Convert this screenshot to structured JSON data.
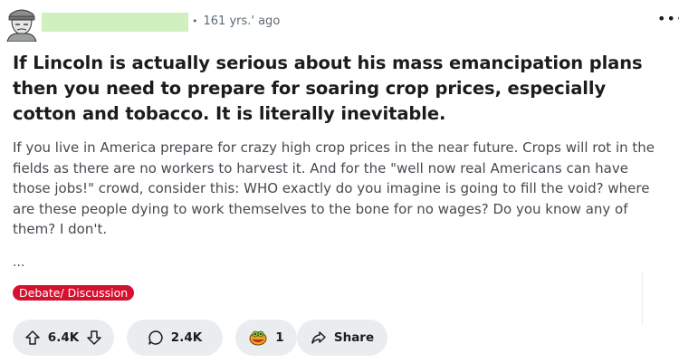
{
  "post": {
    "age": "161 yrs.' ago",
    "more_label": "•••",
    "title": "If Lincoln is actually serious about his mass emancipation plans then you need to prepare for soaring crop prices, especially cotton and tobacco. It is literally inevitable.",
    "body": "If you live in America prepare for crazy high crop prices in the near future. Crops will rot in the fields as there are no workers to harvest it. And for the \"well now real Americans can have those jobs!\" crowd, consider this: WHO exactly do you imagine is going to fill the void? where are these people dying to work themselves to the bone for no wages? Do you know any of them? I don't.",
    "ellipsis": "...",
    "flair": "Debate/ Discussion"
  },
  "actions": {
    "votes": "6.4K",
    "comments": "2.4K",
    "awards": "1",
    "share": "Share"
  },
  "colors": {
    "flair_bg": "#d4112f",
    "pill_bg": "#eaedef",
    "redacted": "#d0f0c0"
  },
  "icons": [
    "avatar",
    "upvote-icon",
    "downvote-icon",
    "comment-icon",
    "award-icon",
    "share-icon",
    "more-icon"
  ]
}
